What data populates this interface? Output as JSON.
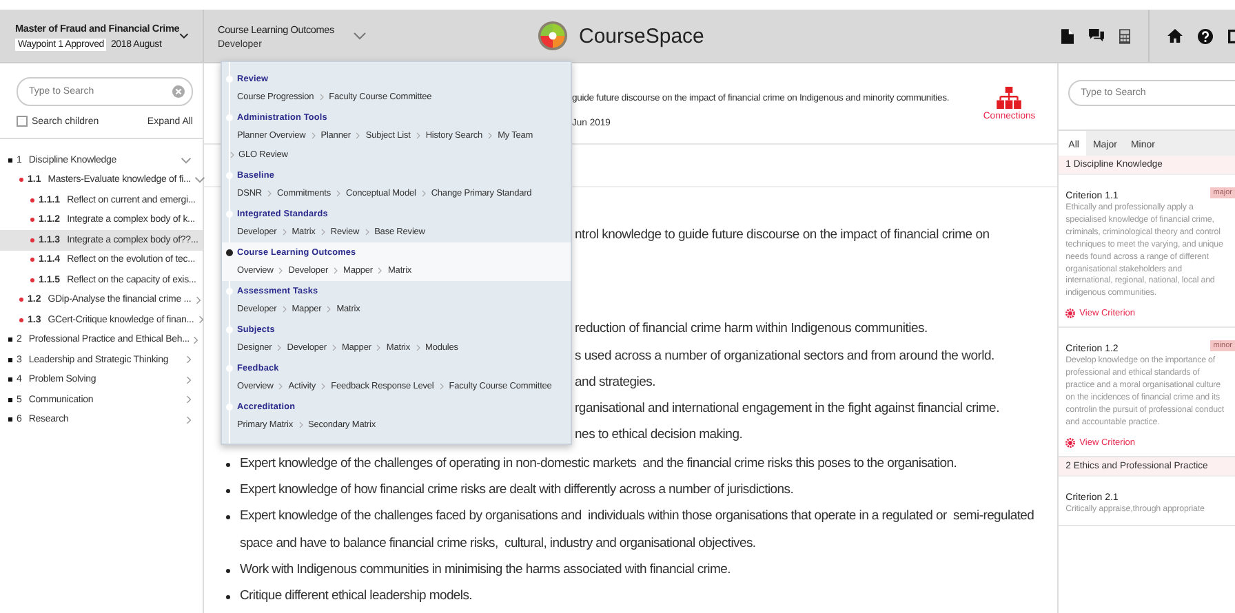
{
  "header": {
    "program": {
      "title": "Master of Fraud and Financial Crime",
      "status": "Waypoint 1 Approved",
      "date": "2018 August"
    },
    "module": {
      "title": "Course Learning Outcomes",
      "subtitle": "Developer"
    },
    "app_name": "CourseSpace"
  },
  "sidebar": {
    "search": {
      "placeholder": "Type to Search"
    },
    "search_children": {
      "label": "Search children",
      "checked": false
    },
    "expand_all": "Expand All",
    "tree": [
      {
        "number": "1",
        "label": "Discipline Knowledge",
        "expanded": true,
        "selected": false,
        "children": [
          {
            "number": "1.1",
            "label": "Masters-Evaluate knowledge of fi...",
            "expanded": true,
            "selected": false,
            "children": [
              {
                "number": "1.1.1",
                "label": "Reflect on current and emergi...",
                "selected": false
              },
              {
                "number": "1.1.2",
                "label": "Integrate a complex body of k...",
                "selected": false
              },
              {
                "number": "1.1.3",
                "label": "Integrate a complex body of??...",
                "selected": true
              },
              {
                "number": "1.1.4",
                "label": "Reflect on the evolution of tec...",
                "selected": false
              },
              {
                "number": "1.1.5",
                "label": "Reflect on the capacity of exis...",
                "selected": false
              }
            ]
          },
          {
            "number": "1.2",
            "label": "GDip-Analyse the financial crime ...",
            "expanded": false,
            "selected": false
          },
          {
            "number": "1.3",
            "label": "GCert-Critique knowledge of finan...",
            "expanded": false,
            "selected": false
          }
        ]
      },
      {
        "number": "2",
        "label": "Professional Practice and Ethical Beh...",
        "expanded": false,
        "selected": false
      },
      {
        "number": "3",
        "label": "Leadership and Strategic Thinking",
        "expanded": false,
        "selected": false
      },
      {
        "number": "4",
        "label": "Problem Solving",
        "expanded": false,
        "selected": false
      },
      {
        "number": "5",
        "label": "Communication",
        "expanded": false,
        "selected": false
      },
      {
        "number": "6",
        "label": "Research",
        "expanded": false,
        "selected": false
      }
    ]
  },
  "menu": {
    "sections": [
      {
        "kind": "heading",
        "title": "Review",
        "selected": false,
        "links": [
          "Course Progression",
          "Faculty Course Committee"
        ]
      },
      {
        "kind": "heading",
        "title": "Administration Tools",
        "selected": false,
        "links": [
          "Planner Overview",
          "Planner",
          "Subject List",
          "History Search",
          "My Team"
        ]
      },
      {
        "kind": "item",
        "links": [
          "GLO Review"
        ]
      },
      {
        "kind": "heading",
        "title": "Baseline",
        "selected": false,
        "links": [
          "DSNR",
          "Commitments",
          "Conceptual Model",
          "Change Primary Standard"
        ]
      },
      {
        "kind": "heading",
        "title": "Integrated Standards",
        "selected": false,
        "links": [
          "Developer",
          "Matrix",
          "Review",
          "Base Review"
        ]
      },
      {
        "kind": "heading",
        "title": "Course Learning Outcomes",
        "selected": true,
        "links": [
          "Overview",
          "Developer",
          "Mapper",
          "Matrix"
        ]
      },
      {
        "kind": "heading",
        "title": "Assessment Tasks",
        "selected": false,
        "links": [
          "Developer",
          "Mapper",
          "Matrix"
        ]
      },
      {
        "kind": "heading",
        "title": "Subjects",
        "selected": false,
        "links": [
          "Designer",
          "Developer",
          "Mapper",
          "Matrix",
          "Modules"
        ]
      },
      {
        "kind": "heading",
        "title": "Feedback",
        "selected": false,
        "links": [
          "Overview",
          "Activity",
          "Feedback Response Level",
          "Faculty Course Committee"
        ]
      },
      {
        "kind": "heading",
        "title": "Accreditation",
        "selected": false,
        "links": [
          "Primary Matrix",
          "Secondary Matrix"
        ]
      }
    ]
  },
  "main": {
    "summary": "guide future discourse on the impact of financial crime on Indigenous and minority communities.",
    "date": "Jun 2019",
    "connections": "Connections",
    "intro": "ntrol knowledge to guide future discourse on the impact of financial crime on",
    "partial_lines": [
      "reduction of financial crime harm within Indigenous communities.",
      "s used across a  number of organizational sectors and from around the world.",
      "and strategies.",
      "rganisational  and international engagement in the fight against financial crime.",
      "nes to ethical decision making."
    ],
    "bullets": [
      "Expert knowledge of the challenges of operating in non-domestic markets  and the financial crime risks this poses to the organisation.",
      "Expert knowledge of how financial crime risks are dealt with differently across a number of jurisdictions.",
      "Expert knowledge of the challenges faced by organisations and  individuals within those organisations that operate in a regulated or  semi-regulated space and have to balance financial crime risks,  cultural, industry and organisational objectives.",
      "Work with Indigenous communities in minimising the harms associated with financial crime.",
      "Critique different ethical leadership models."
    ]
  },
  "right_panel": {
    "search": {
      "placeholder": "Type to Search"
    },
    "tabs": [
      {
        "label": "All",
        "selected": true
      },
      {
        "label": "Major",
        "selected": false
      },
      {
        "label": "Minor",
        "selected": false
      }
    ],
    "groups": [
      {
        "title": "1 Discipline Knowledge",
        "criteria": [
          {
            "title": "Criterion 1.1",
            "badge": "major",
            "description": "Ethically and professionally apply a specialised knowledge of financial crime, criminals, criminological theory and control techniques to meet the varying, and unique needs found across a range of different organisational stakeholders and international, regional, national, local and indigenous communities.",
            "link": "View Criterion"
          },
          {
            "title": "Criterion 1.2",
            "badge": "minor",
            "description": "Develop knowledge on the importance of professional and ethical standards of practice and a moral organisational culture on the incidences of financial crime and its controlin the pursuit of professional conduct and accountable practice.",
            "link": "View Criterion"
          }
        ]
      },
      {
        "title": "2 Ethics and Professional Practice",
        "criteria": [
          {
            "title": "Criterion 2.1",
            "description": "Critically appraise,through appropriate"
          }
        ]
      }
    ]
  }
}
